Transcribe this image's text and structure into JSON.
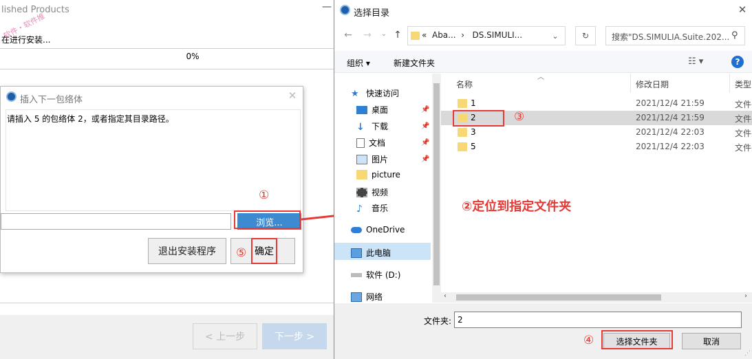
{
  "installer": {
    "title": "lished Products",
    "watermark": "软件・软件推",
    "status": "在进行安装...",
    "progress_text": "0%",
    "progress": 0,
    "back_button": "< 上一步",
    "next_button": "下一步 >"
  },
  "insert_dialog": {
    "title": "插入下一包络体",
    "message": "请插入 5 的包络体 2，或者指定其目录路径。",
    "path_value": "",
    "browse_button": "浏览...",
    "exit_button": "退出安装程序",
    "ok_button": "确定"
  },
  "picker": {
    "title": "选择目录",
    "address_sep": "«",
    "address": [
      "Aba...",
      "DS.SIMULI..."
    ],
    "search_placeholder": "搜索\"DS.SIMULIA.Suite.202...",
    "toolbar": {
      "organize": "组织 ▾",
      "new_folder": "新建文件夹"
    },
    "sidebar": [
      {
        "label": "快速访问",
        "icon": "star-icon",
        "pinned": false
      },
      {
        "label": "桌面",
        "icon": "desktop-icon",
        "pinned": true
      },
      {
        "label": "下载",
        "icon": "download-icon",
        "pinned": true
      },
      {
        "label": "文档",
        "icon": "document-icon",
        "pinned": true
      },
      {
        "label": "图片",
        "icon": "picture-icon",
        "pinned": true
      },
      {
        "label": "picture",
        "icon": "folder-icon",
        "pinned": false
      },
      {
        "label": "视频",
        "icon": "video-icon",
        "pinned": false
      },
      {
        "label": "音乐",
        "icon": "music-icon",
        "pinned": false
      },
      {
        "label": "OneDrive",
        "icon": "cloud-icon",
        "pinned": false
      },
      {
        "label": "此电脑",
        "icon": "computer-icon",
        "pinned": false
      },
      {
        "label": "软件 (D:)",
        "icon": "drive-icon",
        "pinned": false
      },
      {
        "label": "网络",
        "icon": "network-icon",
        "pinned": false
      }
    ],
    "columns": {
      "name": "名称",
      "date": "修改日期",
      "type": "类型"
    },
    "files": [
      {
        "name": "1",
        "date": "2021/12/4 21:59",
        "type": "文件夹"
      },
      {
        "name": "2",
        "date": "2021/12/4 21:59",
        "type": "文件夹"
      },
      {
        "name": "3",
        "date": "2021/12/4 22:03",
        "type": "文件夹"
      },
      {
        "name": "5",
        "date": "2021/12/4 22:03",
        "type": "文件夹"
      }
    ],
    "folder_label": "文件夹:",
    "folder_value": "2",
    "select_button": "选择文件夹",
    "cancel_button": "取消"
  },
  "annotations": {
    "step1": "①",
    "step2": "②定位到指定文件夹",
    "step3": "③",
    "step4": "④",
    "step5": "⑤",
    "color": "#e53935"
  }
}
